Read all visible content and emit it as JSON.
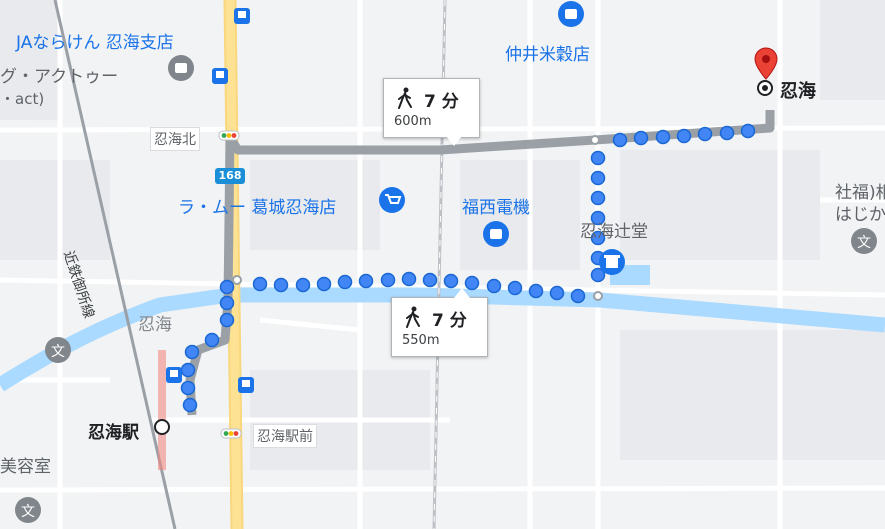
{
  "places": {
    "ja": "JAならけん 忍海支店",
    "act_line1": "グ・アクトゥー",
    "act_line2": "・act)",
    "nakai": "仲井米穀店",
    "oshimi_dest": "忍海",
    "oshimi_kita": "忍海北",
    "ramu": "ラ・ムー 葛城忍海店",
    "fukunishi": "福西電機",
    "oshimi_tsuji": "忍海辻堂",
    "shafuku_line1": "社福)相",
    "shafuku_line2": "はじか",
    "oshimi_area": "忍海",
    "railway": "近鉄御所線",
    "station": "忍海駅",
    "station_mae": "忍海駅前",
    "beauty": "美容室"
  },
  "route_labels": {
    "upper": {
      "time": "7 分",
      "distance": "600m"
    },
    "lower": {
      "time": "7 分",
      "distance": "550m"
    }
  },
  "highway": "168",
  "icons": {
    "walk": "walking-person-icon",
    "pin": "red-destination-pin-icon",
    "bus": "bus-stop-icon",
    "school": "school-icon",
    "shop": "shopping-bag-icon",
    "cart": "shopping-cart-icon",
    "temple": "temple-icon",
    "traffic": "traffic-light-icon"
  },
  "colors": {
    "walk_route_blue": "#4285f4",
    "alt_route_gray": "#9aa0a6",
    "river": "#aadaff",
    "highway_yellow": "#fde293",
    "pin_red": "#ea4335",
    "label_blue": "#1a73e8"
  }
}
